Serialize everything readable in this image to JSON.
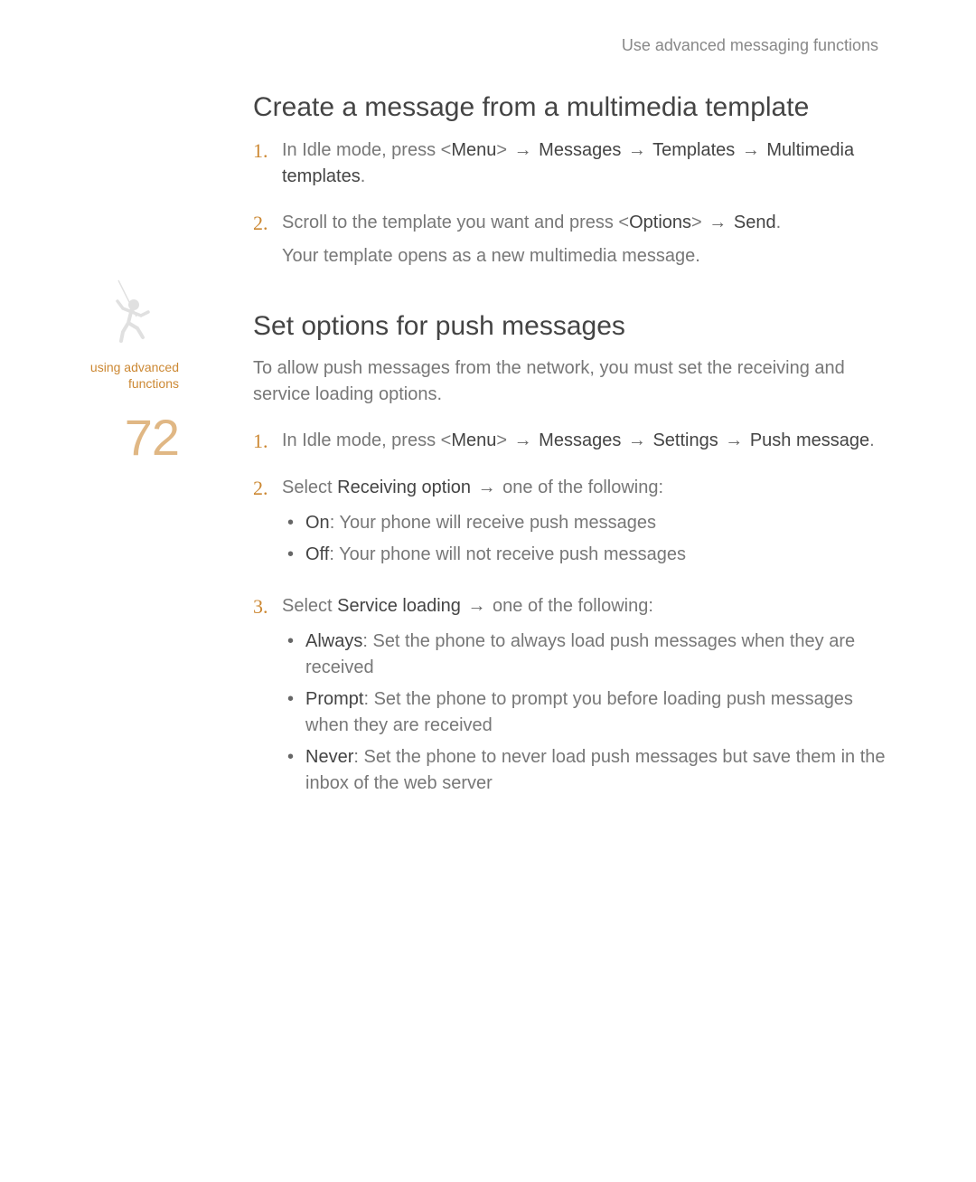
{
  "header": "Use advanced messaging functions",
  "sidebar": {
    "label_line1": "using advanced",
    "label_line2": "functions",
    "page_number": "72"
  },
  "section1": {
    "heading": "Create a message from a multimedia template",
    "steps": [
      {
        "num": "1.",
        "parts": [
          "In Idle mode, press <",
          "Menu",
          "> ",
          "→",
          " ",
          "Messages",
          " ",
          "→",
          " ",
          "Templates",
          " ",
          "→",
          " ",
          "Multimedia templates",
          "."
        ]
      },
      {
        "num": "2.",
        "parts": [
          "Scroll to the template you want and press <",
          "Options",
          "> ",
          "→",
          " ",
          "Send",
          "."
        ],
        "note": "Your template opens as a new multimedia message."
      }
    ]
  },
  "section2": {
    "heading": "Set options for push messages",
    "intro": "To allow push messages from the network, you must set the receiving and service loading options.",
    "steps": [
      {
        "num": "1.",
        "parts": [
          "In Idle mode, press <",
          "Menu",
          "> ",
          "→",
          " ",
          "Messages",
          " ",
          "→",
          " ",
          "Settings",
          " ",
          "→",
          " ",
          "Push message",
          "."
        ]
      },
      {
        "num": "2.",
        "parts": [
          "Select ",
          "Receiving option",
          " ",
          "→",
          " one of the following:"
        ],
        "bullets": [
          {
            "label": "On",
            "text": ": Your phone will receive push messages"
          },
          {
            "label": "Off",
            "text": ": Your phone will not receive push messages"
          }
        ]
      },
      {
        "num": "3.",
        "parts": [
          "Select ",
          "Service loading",
          " ",
          "→",
          " one of the following:"
        ],
        "bullets": [
          {
            "label": "Always",
            "text": ": Set the phone to always load push messages when they are received"
          },
          {
            "label": "Prompt",
            "text": ": Set the phone to prompt you before loading push messages when they are received"
          },
          {
            "label": "Never",
            "text": ": Set the phone to never load push messages but save them in the inbox of the web server"
          }
        ]
      }
    ]
  }
}
